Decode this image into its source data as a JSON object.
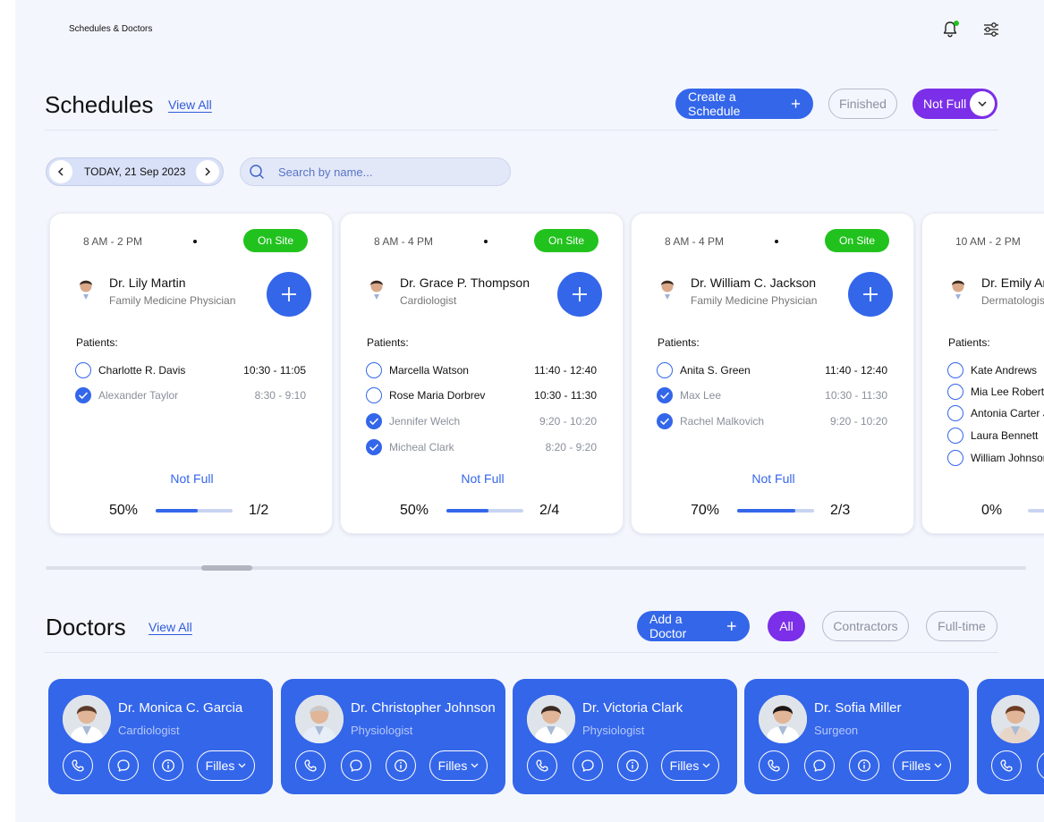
{
  "header": {
    "breadcrumb": "Schedules & Doctors"
  },
  "colors": {
    "primary": "#3466ea",
    "violet": "#7b2fe8",
    "green": "#22c21e",
    "page_bg": "#f4f6fd"
  },
  "schedules": {
    "title": "Schedules",
    "view_all": "View All",
    "create_label": "Create a Schedule",
    "finished_label": "Finished",
    "notfull_label": "Not Full",
    "date_label": "TODAY, 21 Sep 2023",
    "search_placeholder": "Search by name...",
    "patients_label": "Patients:",
    "cards": [
      {
        "time": "8 AM - 2 PM",
        "badge": "On Site",
        "doctor": "Dr. Lily Martin",
        "role": "Family Medicine Physician",
        "patients": [
          {
            "name": "Charlotte R. Davis",
            "time": "10:30 - 11:05",
            "done": false
          },
          {
            "name": "Alexander Taylor",
            "time": "8:30 - 9:10",
            "done": true
          }
        ],
        "status": "Not Full",
        "percent": "50%",
        "progress": 0.55,
        "count": "1/2"
      },
      {
        "time": "8 AM - 4 PM",
        "badge": "On Site",
        "doctor": "Dr. Grace P. Thompson",
        "role": "Cardiologist",
        "patients": [
          {
            "name": "Marcella Watson",
            "time": "11:40 - 12:40",
            "done": false
          },
          {
            "name": "Rose Maria Dorbrev",
            "time": "10:30 - 11:30",
            "done": false
          },
          {
            "name": "Jennifer Welch",
            "time": "9:20 - 10:20",
            "done": true
          },
          {
            "name": "Micheal Clark",
            "time": "8:20 - 9:20",
            "done": true
          }
        ],
        "status": "Not Full",
        "percent": "50%",
        "progress": 0.55,
        "count": "2/4"
      },
      {
        "time": "8 AM - 4 PM",
        "badge": "On Site",
        "doctor": "Dr. William C. Jackson",
        "role": "Family Medicine Physician",
        "patients": [
          {
            "name": "Anita S. Green",
            "time": "11:40 - 12:40",
            "done": false
          },
          {
            "name": "Max Lee",
            "time": "10:30 - 11:30",
            "done": true
          },
          {
            "name": "Rachel Malkovich",
            "time": "9:20 - 10:20",
            "done": true
          }
        ],
        "status": "Not Full",
        "percent": "70%",
        "progress": 0.75,
        "count": "2/3"
      },
      {
        "time": "10 AM - 2 PM",
        "badge": "",
        "doctor": "Dr. Emily An",
        "role": "Dermatologist",
        "patients": [
          {
            "name": "Kate Andrews",
            "time": "",
            "done": false
          },
          {
            "name": "Mia Lee Roberts",
            "time": "",
            "done": false
          },
          {
            "name": "Antonia Carter J",
            "time": "",
            "done": false
          },
          {
            "name": "Laura Bennett",
            "time": "",
            "done": false
          },
          {
            "name": "William Johnson",
            "time": "",
            "done": false
          }
        ],
        "status": "",
        "percent": "0%",
        "progress": 0,
        "count": ""
      }
    ]
  },
  "doctors": {
    "title": "Doctors",
    "view_all": "View All",
    "add_label": "Add a Doctor",
    "filter_all": "All",
    "filter_contractors": "Contractors",
    "filter_fulltime": "Full-time",
    "files_label": "Filles",
    "cards": [
      {
        "name": "Dr. Monica C. Garcia",
        "role": "Cardiologist"
      },
      {
        "name": "Dr. Christopher Johnson",
        "role": "Physiologist"
      },
      {
        "name": "Dr. Victoria Clark",
        "role": "Physiologist"
      },
      {
        "name": "Dr. Sofia Miller",
        "role": "Surgeon"
      },
      {
        "name": "",
        "role": ""
      }
    ]
  }
}
